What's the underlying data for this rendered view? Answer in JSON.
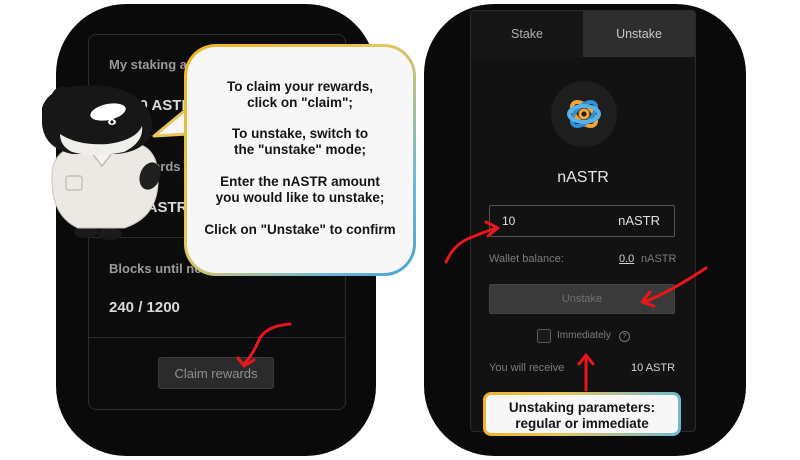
{
  "left_panel": {
    "staking_label": "My staking amount",
    "staking_value": "0.0 ASTR",
    "rewards_label": "My rewards",
    "rewards_value": "0 nASTR",
    "blocks_label": "Blocks until next era",
    "blocks_value": "240 / 1200",
    "claim_button": "Claim rewards"
  },
  "speech_bubble": {
    "line1": "To claim your rewards,",
    "line2": "click on \"claim\";",
    "line3": "To unstake, switch to",
    "line4": "the \"unstake\" mode;",
    "line5": "Enter the nASTR amount",
    "line6": "you would like to unstake;",
    "line7": "Click on \"Unstake\" to confirm"
  },
  "right_panel": {
    "tabs": [
      {
        "label": "Stake",
        "active": false
      },
      {
        "label": "Unstake",
        "active": true
      }
    ],
    "token_name": "nASTR",
    "amount_input": {
      "value": "10",
      "unit": "nASTR"
    },
    "wallet_balance_label": "Wallet balance:",
    "wallet_balance_value": "0.0",
    "wallet_balance_unit": "nASTR",
    "unstake_button": "Unstake",
    "immediately_label": "Immediately",
    "receive_label": "You will receive",
    "receive_value": "10 ASTR"
  },
  "params_callout": {
    "line1": "Unstaking parameters:",
    "line2": "regular or immediate"
  },
  "colors": {
    "panel_bg": "#0a0a0a",
    "callout_border_start": "#f0b429",
    "callout_border_end": "#4aa3cc",
    "arrow": "#e8161b"
  }
}
